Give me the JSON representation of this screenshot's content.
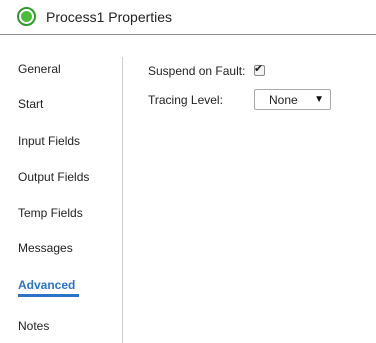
{
  "header": {
    "title": "Process1 Properties",
    "status_color": "#4cbb3a"
  },
  "sidebar": {
    "active_color": "#2a73c8",
    "items": [
      {
        "label": "General"
      },
      {
        "label": "Start"
      },
      {
        "label": "Input Fields"
      },
      {
        "label": "Output Fields"
      },
      {
        "label": "Temp Fields"
      },
      {
        "label": "Messages"
      },
      {
        "label": "Advanced",
        "active": true
      },
      {
        "label": "Notes"
      }
    ]
  },
  "advanced": {
    "suspend_on_fault": {
      "label": "Suspend on Fault:",
      "checked": true
    },
    "tracing_level": {
      "label": "Tracing Level:",
      "value": "None"
    }
  }
}
